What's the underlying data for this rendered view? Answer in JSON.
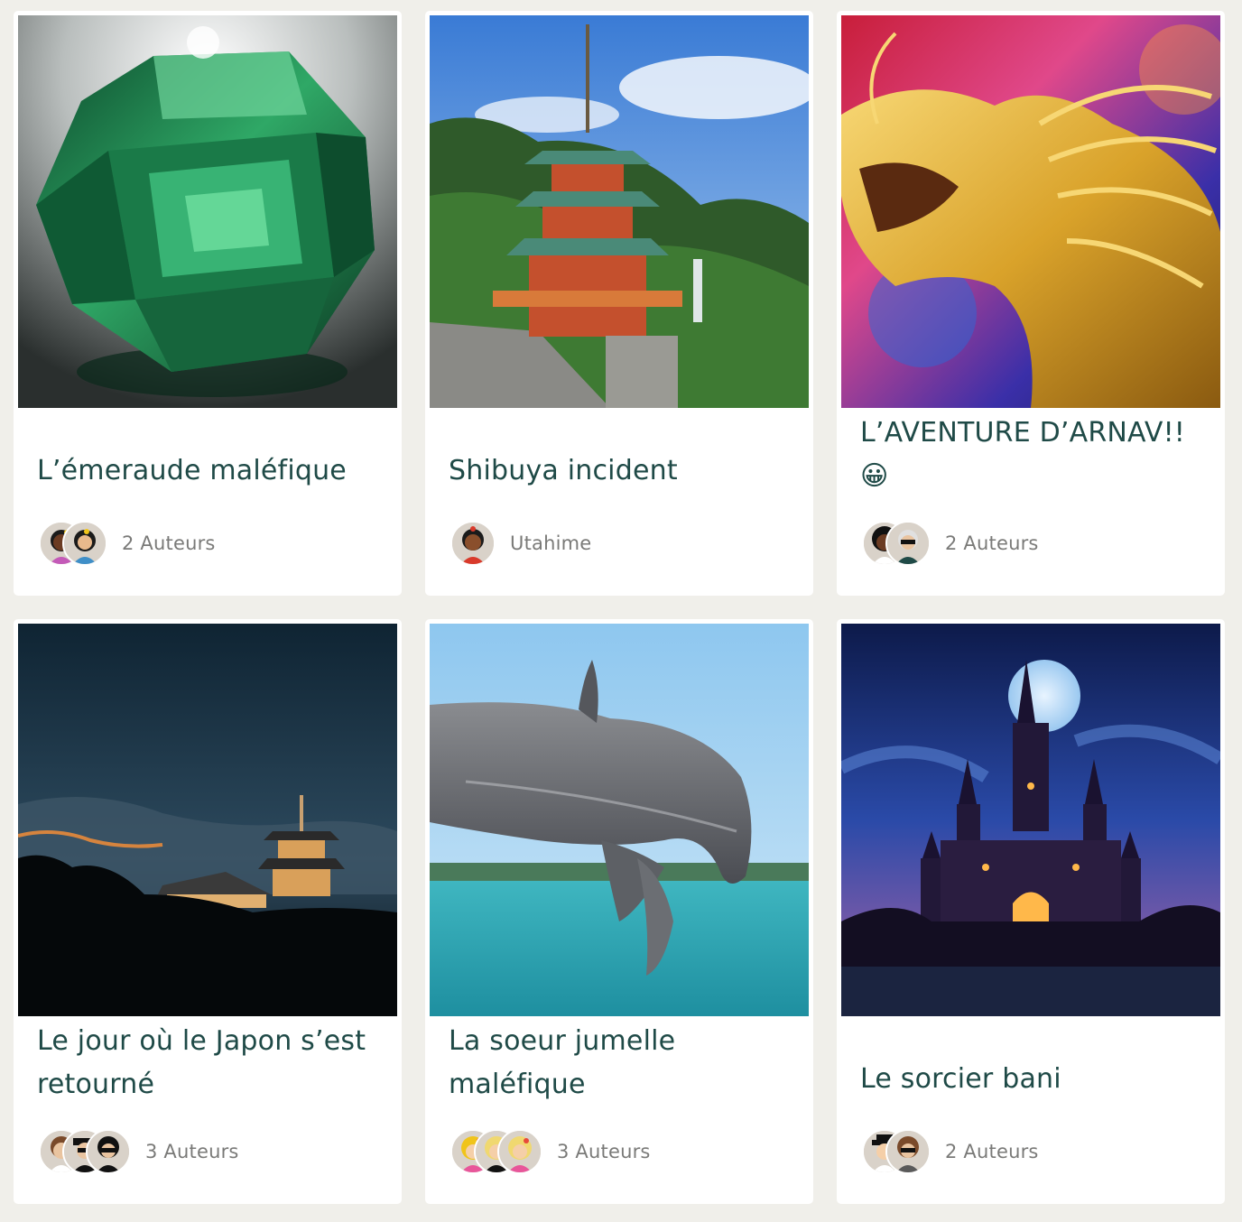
{
  "stories": [
    {
      "title": "L’émeraude maléfique",
      "authors_label": "2 Auteurs",
      "image": "emerald-gem",
      "avatar_count": 2
    },
    {
      "title": "Shibuya incident",
      "authors_label": "Utahime",
      "image": "japanese-pagoda",
      "avatar_count": 1
    },
    {
      "title": "L’AVENTURE D’ARNAV!! 😀",
      "authors_label": "2 Auteurs",
      "image": "golden-dragon",
      "avatar_count": 2
    },
    {
      "title": "Le jour où le Japon s’est retourné",
      "authors_label": "3 Auteurs",
      "image": "night-temple",
      "avatar_count": 3
    },
    {
      "title": "La soeur jumelle maléfique",
      "authors_label": "3 Auteurs",
      "image": "leaping-dolphin",
      "avatar_count": 3
    },
    {
      "title": "Le sorcier bani",
      "authors_label": "2 Auteurs",
      "image": "dark-castle",
      "avatar_count": 2
    }
  ],
  "colors": {
    "page_background": "#f0efea",
    "card_background": "#ffffff",
    "title_text": "#1f4a47",
    "meta_text": "#7a7a78"
  }
}
